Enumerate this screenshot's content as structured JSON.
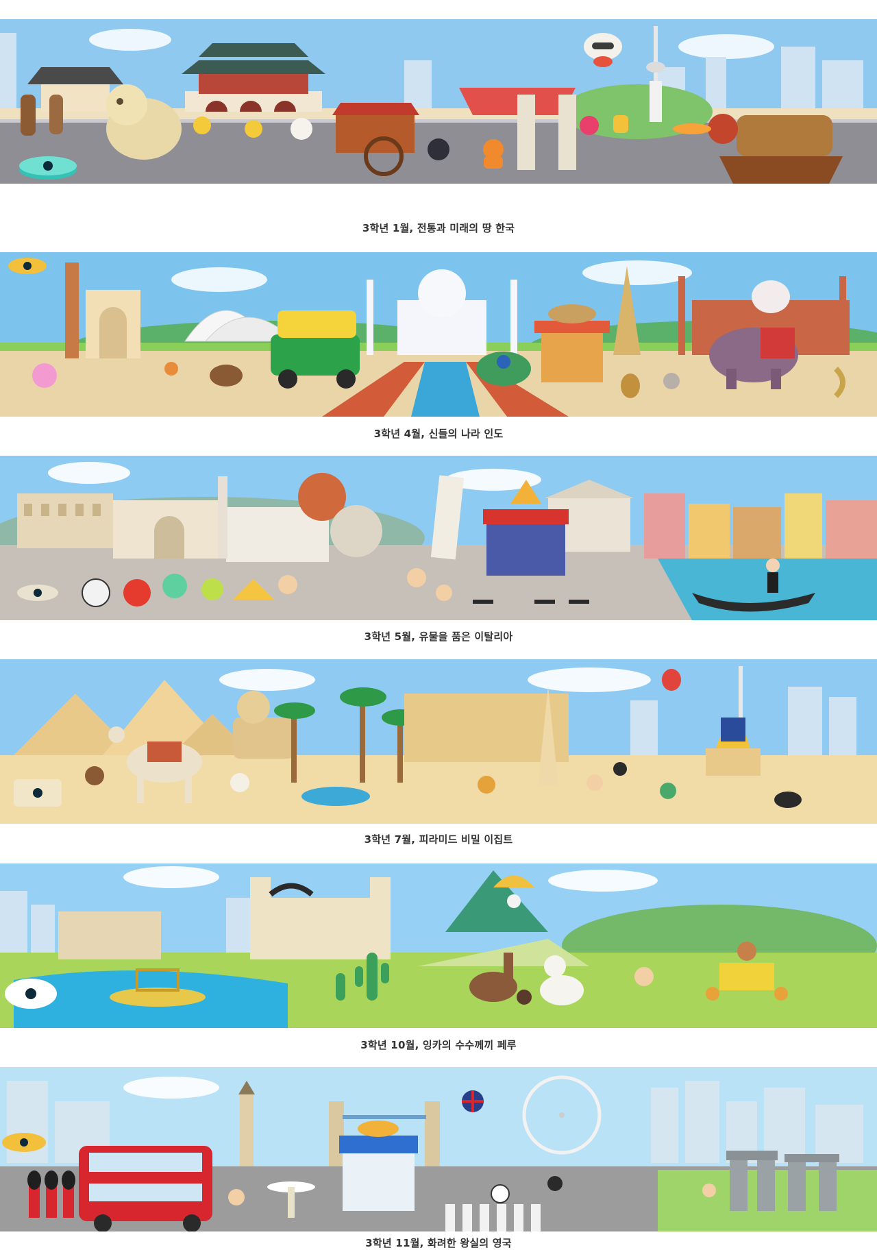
{
  "banners": [
    {
      "caption": "3학년 1월, 전통과 미래의 땅 한국",
      "scene": "korea",
      "colors": {
        "sky": "#8fc9f0",
        "ground": "#8f8f95",
        "accent": "#e8d3a8"
      },
      "icons": [
        "palace-icon",
        "haechi-statue-icon",
        "cart-icon",
        "tower-icon",
        "turtle-ship-icon",
        "robot-icon",
        "tiger-icon",
        "portal-ring-icon"
      ]
    },
    {
      "caption": "3학년 4월, 신들의 나라 인도",
      "scene": "india",
      "colors": {
        "sky": "#7cc3ee",
        "ground": "#ead5a8",
        "accent": "#3aa7d8"
      },
      "icons": [
        "taj-mahal-icon",
        "lotus-temple-icon",
        "india-gate-icon",
        "auto-rickshaw-icon",
        "peacock-icon",
        "elephant-icon",
        "food-stall-icon",
        "portal-ring-icon"
      ]
    },
    {
      "caption": "3학년 5월, 유물을 품은 이탈리아",
      "scene": "italy",
      "colors": {
        "sky": "#8ecbf2",
        "ground": "#c7c0b8",
        "accent": "#48b6d4"
      },
      "icons": [
        "colosseum-icon",
        "arch-icon",
        "duomo-icon",
        "pisa-tower-icon",
        "pantheon-icon",
        "gondola-icon",
        "pizza-shop-icon",
        "portal-ring-icon"
      ]
    },
    {
      "caption": "3학년 7월, 피라미드 비밀 이집트",
      "scene": "egypt",
      "colors": {
        "sky": "#8fcaf2",
        "ground": "#f1dca8",
        "accent": "#3da9d6"
      },
      "icons": [
        "pyramid-icon",
        "sphinx-icon",
        "camel-icon",
        "palm-tree-icon",
        "obelisk-icon",
        "pharaoh-mask-icon",
        "balloon-icon",
        "portal-ring-icon"
      ]
    },
    {
      "caption": "3학년 10월, 잉카의 수수께끼 페루",
      "scene": "peru",
      "colors": {
        "sky": "#96d0f4",
        "ground": "#a9d65a",
        "accent": "#2fb1e0"
      },
      "icons": [
        "cathedral-icon",
        "reed-boat-icon",
        "cactus-icon",
        "llama-icon",
        "alpaca-icon",
        "condor-icon",
        "paraglider-icon",
        "portal-ring-icon"
      ]
    },
    {
      "caption": "3학년 11월, 화려한 왕실의 영국",
      "scene": "uk",
      "colors": {
        "sky": "#b9e2f7",
        "ground": "#9c9c9c",
        "accent": "#d7262e"
      },
      "icons": [
        "double-decker-bus-icon",
        "guard-icon",
        "london-eye-icon",
        "tower-bridge-icon",
        "stonehenge-icon",
        "fish-and-chips-shop-icon",
        "big-ben-icon",
        "portal-ring-icon"
      ]
    }
  ]
}
